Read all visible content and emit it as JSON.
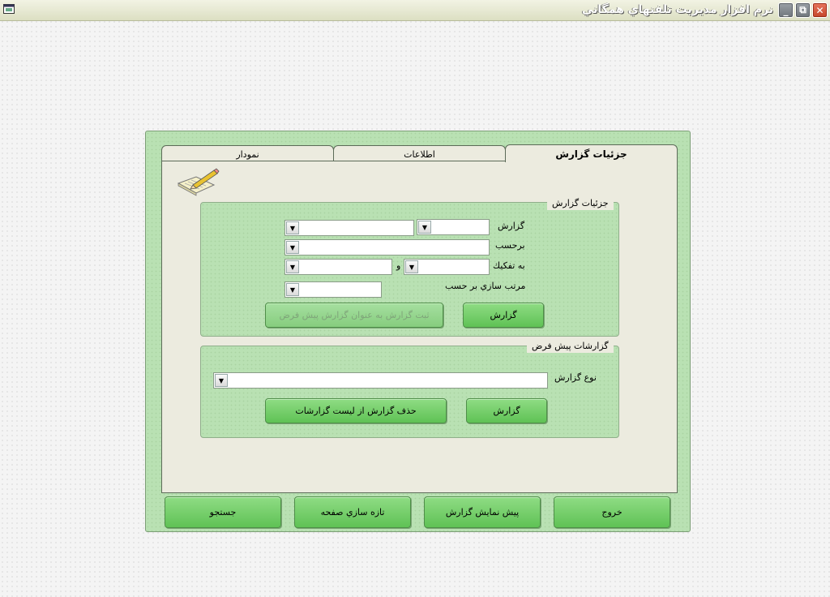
{
  "window": {
    "title": "نرم افزار مديريت تلفنهاي همگاني",
    "controls": {
      "minimize": "_",
      "restore": "⧉",
      "close": "✕"
    }
  },
  "tabs": [
    {
      "label": "جزئيات گزارش",
      "active": true
    },
    {
      "label": "اطلاعات",
      "active": false
    },
    {
      "label": "نمودار",
      "active": false
    }
  ],
  "report_details": {
    "title": "جزئيات گزارش",
    "report_label": "گزارش",
    "by_label": "برحسب",
    "breakdown_label": "به تفکيك",
    "and_label": "و",
    "sort_label": "مرتب سازي بر حسب",
    "report_button": "گزارش",
    "save_default_button": "ثبت گزارش به عنوان گزارش پيش فرض"
  },
  "default_reports": {
    "title": "گزارشات پيش فرض",
    "type_label": "نوع گزارش",
    "report_button": "گزارش",
    "delete_button": "حذف گزارش از ليست گزارشات"
  },
  "footer": {
    "exit": "خروج",
    "preview": "پيش نمايش گزارش",
    "refresh": "تازه سازي صفحه",
    "search": "جستجو"
  },
  "colors": {
    "frame": "#b9e1b3",
    "button": "#6fcb64",
    "panel": "#ecebdf"
  },
  "icons": [
    "app-icon",
    "notepad-pencil-icon",
    "chevron-down-icon"
  ]
}
